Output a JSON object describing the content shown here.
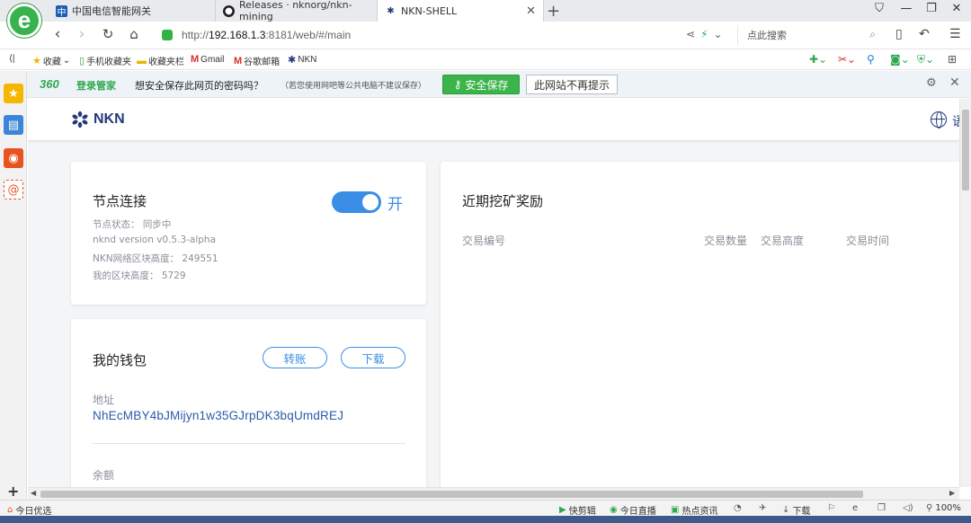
{
  "browser": {
    "logo_letter": "e",
    "tabs": [
      {
        "label": "中国电信智能网关",
        "icon": "telecom-icon"
      },
      {
        "label": "Releases · nknorg/nkn-mining",
        "icon": "github-icon"
      },
      {
        "label": "NKN-SHELL",
        "icon": "nkn-icon",
        "active": true
      }
    ],
    "new_tab_symbol": "+",
    "address": {
      "protocol": "http://",
      "host": "192.168.1.3",
      "rest": ":8181/web/#/main"
    },
    "search_placeholder": "点此搜索",
    "bookmarks": [
      {
        "label": "收藏",
        "icon": "star-icon"
      },
      {
        "label": "手机收藏夹",
        "icon": "phone-icon"
      },
      {
        "label": "收藏夹栏",
        "icon": "folder-icon"
      },
      {
        "label": "Gmail",
        "icon": "gmail-icon"
      },
      {
        "label": "谷歌邮箱",
        "icon": "gmail-icon"
      },
      {
        "label": "NKN",
        "icon": "nkn-icon"
      }
    ]
  },
  "password_bar": {
    "logo": "360",
    "logo_text": "登录管家",
    "question": "想安全保存此网页的密码吗？",
    "note": "（若您使用网吧等公共电脑不建议保存）",
    "save_label": "安全保存",
    "never_label": "此网站不再提示"
  },
  "app": {
    "logo_text": "NKN",
    "lang_label": "语",
    "node_card": {
      "title": "节点连接",
      "toggle_on": true,
      "toggle_label": "开",
      "status": "节点状态： 同步中",
      "version": "nknd version v0.5.3-alpha",
      "network_height": "NKN网络区块高度： 249551",
      "my_height": "我的区块高度： 5729"
    },
    "wallet_card": {
      "title": "我的钱包",
      "transfer_label": "转账",
      "download_label": "下载",
      "address_label": "地址",
      "address": "NhEcMBY4bJMijyn1w35GJrpDK3bqUmdREJ",
      "balance_label": "余额"
    },
    "rewards_card": {
      "title": "近期挖矿奖励",
      "columns": [
        "交易编号",
        "交易数量",
        "交易高度",
        "交易时间"
      ]
    }
  },
  "statusbar": {
    "left_label": "今日优选",
    "items": [
      "快剪辑",
      "今日直播",
      "热点资讯",
      "下载"
    ],
    "zoom": "100%"
  },
  "colors": {
    "accent": "#3a8ee6",
    "brand": "#233a7c",
    "green": "#3bb54a"
  }
}
